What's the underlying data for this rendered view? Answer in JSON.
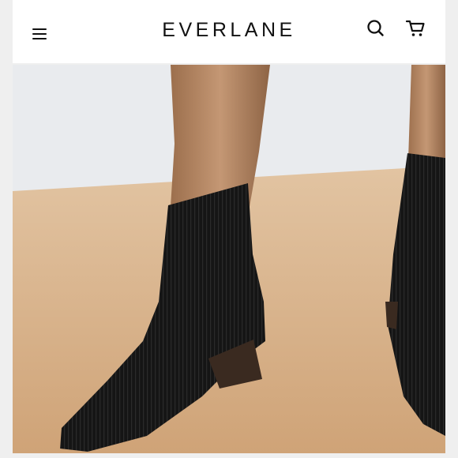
{
  "header": {
    "brand": "EVERLANE",
    "menu_icon": "hamburger-menu-icon",
    "search_icon": "search-icon",
    "cart_icon": "cart-icon"
  },
  "product_image": {
    "description_icon": "product-photo",
    "colors": {
      "wall": "#e9ebee",
      "floor": "#d9b48e",
      "boot": "#161616",
      "skin": "#b98b66",
      "heel": "#3a2a20"
    }
  }
}
